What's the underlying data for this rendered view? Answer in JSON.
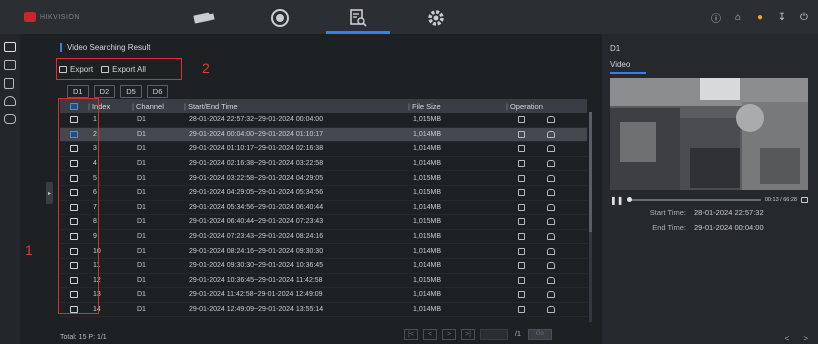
{
  "brand": {
    "logo_text": "HIKVISION"
  },
  "topnav": [
    {
      "name": "camera-icon"
    },
    {
      "name": "playback-icon"
    },
    {
      "name": "search-icon"
    },
    {
      "name": "settings-icon"
    }
  ],
  "top_right_icons": [
    "info-icon",
    "home-icon",
    "user-icon",
    "download-icon",
    "power-icon"
  ],
  "left_rail": [
    "video-file-icon",
    "picture-icon",
    "document-icon",
    "person-icon",
    "vehicle-icon"
  ],
  "section_title": "Video Searching Result",
  "export": {
    "export_label": "Export",
    "export_all_label": "Export All"
  },
  "annotations": {
    "label_1": "1",
    "label_2": "2"
  },
  "channel_tabs": [
    "D1",
    "D2",
    "D5",
    "D6"
  ],
  "table": {
    "headers": {
      "index": "Index",
      "channel": "Channel",
      "time": "Start/End Time",
      "size": "File Size",
      "operation": "Operation"
    },
    "rows": [
      {
        "index": "1",
        "channel": "D1",
        "time": "28-01-2024 22:57:32~29-01-2024 00:04:00",
        "size": "1,015MB",
        "selected": false
      },
      {
        "index": "2",
        "channel": "D1",
        "time": "29-01-2024 00:04:00~29-01-2024 01:10:17",
        "size": "1,014MB",
        "selected": true
      },
      {
        "index": "3",
        "channel": "D1",
        "time": "29-01-2024 01:10:17~29-01-2024 02:16:38",
        "size": "1,014MB",
        "selected": false
      },
      {
        "index": "4",
        "channel": "D1",
        "time": "29-01-2024 02:16:38~29-01-2024 03:22:58",
        "size": "1,014MB",
        "selected": false
      },
      {
        "index": "5",
        "channel": "D1",
        "time": "29-01-2024 03:22:58~29-01-2024 04:29:05",
        "size": "1,015MB",
        "selected": false
      },
      {
        "index": "6",
        "channel": "D1",
        "time": "29-01-2024 04:29:05~29-01-2024 05:34:56",
        "size": "1,015MB",
        "selected": false
      },
      {
        "index": "7",
        "channel": "D1",
        "time": "29-01-2024 05:34:56~29-01-2024 06:40:44",
        "size": "1,014MB",
        "selected": false
      },
      {
        "index": "8",
        "channel": "D1",
        "time": "29-01-2024 06:40:44~29-01-2024 07:23:43",
        "size": "1,015MB",
        "selected": false
      },
      {
        "index": "9",
        "channel": "D1",
        "time": "29-01-2024 07:23:43~29-01-2024 08:24:16",
        "size": "1,015MB",
        "selected": false
      },
      {
        "index": "10",
        "channel": "D1",
        "time": "29-01-2024 08:24:16~29-01-2024 09:30:30",
        "size": "1,014MB",
        "selected": false
      },
      {
        "index": "11",
        "channel": "D1",
        "time": "29-01-2024 09:30:30~29-01-2024 10:36:45",
        "size": "1,014MB",
        "selected": false
      },
      {
        "index": "12",
        "channel": "D1",
        "time": "29-01-2024 10:36:45~29-01-2024 11:42:58",
        "size": "1,015MB",
        "selected": false
      },
      {
        "index": "13",
        "channel": "D1",
        "time": "29-01-2024 11:42:58~29-01-2024 12:49:09",
        "size": "1,014MB",
        "selected": false
      },
      {
        "index": "14",
        "channel": "D1",
        "time": "29-01-2024 12:49:09~29-01-2024 13:55:14",
        "size": "1,014MB",
        "selected": false
      }
    ]
  },
  "footer": {
    "total": "Total: 15  P: 1/1"
  },
  "pager": {
    "first": "|<",
    "prev": "<",
    "next": ">",
    "last": ">|",
    "total_pages": "/1",
    "go": "Go"
  },
  "preview": {
    "channel": "D1",
    "tab": "Video",
    "play_time": "00:13 / 66:28",
    "start_label": "Start Time:",
    "start_value": "28-01-2024 22:57:32",
    "end_label": "End Time:",
    "end_value": "29-01-2024 00:04:00",
    "prev_nav": "<",
    "next_nav": ">"
  },
  "colors": {
    "accent": "#3d7fe0",
    "annotation": "#e32b2b"
  }
}
